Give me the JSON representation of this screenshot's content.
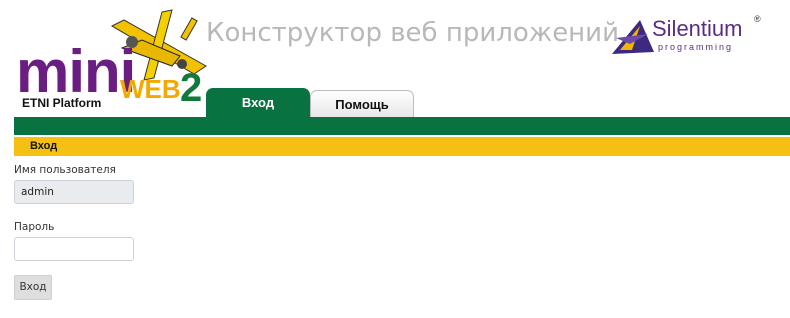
{
  "logo": {
    "mini": "mini",
    "platform": "ETNI Platform",
    "web": "WEB",
    "version": "2"
  },
  "header": {
    "title": "Конструктор веб приложений"
  },
  "brand": {
    "name": "Silentium",
    "sub": "programming",
    "reg": "®"
  },
  "tabs": [
    {
      "label": "Вход",
      "active": true
    },
    {
      "label": "Помощь",
      "active": false
    }
  ],
  "breadcrumb": {
    "label": "Вход"
  },
  "form": {
    "username_label": "Имя пользователя",
    "username_value": "admin",
    "password_label": "Пароль",
    "password_value": "",
    "submit_label": "Вход"
  },
  "colors": {
    "green": "#087340",
    "yellow": "#f5c012",
    "logo_purple": "#6b1e82"
  }
}
